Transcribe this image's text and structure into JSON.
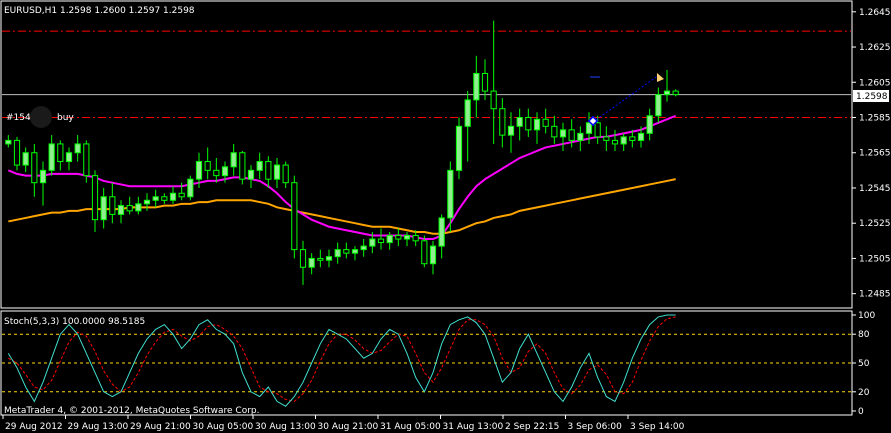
{
  "symbol_header": "EURUSD,H1  1.2598 1.2600 1.2597 1.2598",
  "trade_label_id": "#154",
  "trade_label_side": "buy",
  "current_price_label": "1.2598",
  "stoch_header": "Stoch(5,3,3) 100.0000 98.5185",
  "copyright": "MetaTrader 4, © 2001-2012, MetaQuotes Software Corp.",
  "colors": {
    "background": "#000000",
    "grid_axis": "#ffffff",
    "bull_candle": "#90ee90",
    "bear_candle": "#000000",
    "candle_wick": "#00ff00",
    "ma_fast": "#ff00ff",
    "ma_slow": "#ffa500",
    "level_lines": "#ff0000",
    "stoch_main": "#40e0d0",
    "stoch_signal": "#ff0000",
    "stoch_levels": "#ffd700",
    "trade_line": "#0000ff"
  },
  "chart_data": [
    {
      "type": "candlestick",
      "title": "EURUSD,H1",
      "ylim": [
        1.2478,
        1.265
      ],
      "y_ticks": [
        "1.2645",
        "1.2625",
        "1.2605",
        "1.2585",
        "1.2565",
        "1.2545",
        "1.2525",
        "1.2505",
        "1.2485"
      ],
      "x_ticks": [
        "29 Aug 2012",
        "29 Aug 13:00",
        "29 Aug 21:00",
        "30 Aug 05:00",
        "30 Aug 13:00",
        "30 Aug 21:00",
        "31 Aug 05:00",
        "31 Aug 13:00",
        "2 Sep 22:15",
        "3 Sep 06:00",
        "3 Sep 14:00"
      ],
      "horizontal_levels": [
        1.2634,
        1.2585
      ],
      "current_price": 1.2598,
      "candles": [
        [
          1.257,
          1.2575,
          1.2568,
          1.2572
        ],
        [
          1.2572,
          1.2574,
          1.2555,
          1.2558
        ],
        [
          1.2558,
          1.2568,
          1.2554,
          1.2565
        ],
        [
          1.2565,
          1.257,
          1.254,
          1.2548
        ],
        [
          1.2548,
          1.256,
          1.2535,
          1.2555
        ],
        [
          1.2555,
          1.2575,
          1.2552,
          1.257
        ],
        [
          1.257,
          1.2572,
          1.2555,
          1.256
        ],
        [
          1.256,
          1.2568,
          1.2555,
          1.2565
        ],
        [
          1.2565,
          1.2575,
          1.256,
          1.257
        ],
        [
          1.257,
          1.2572,
          1.2548,
          1.2552
        ],
        [
          1.2552,
          1.2555,
          1.252,
          1.2527
        ],
        [
          1.2527,
          1.2545,
          1.2522,
          1.254
        ],
        [
          1.254,
          1.2548,
          1.2525,
          1.253
        ],
        [
          1.253,
          1.2538,
          1.2525,
          1.2535
        ],
        [
          1.2535,
          1.254,
          1.253,
          1.2532
        ],
        [
          1.2532,
          1.254,
          1.253,
          1.2536
        ],
        [
          1.2536,
          1.2542,
          1.2532,
          1.2538
        ],
        [
          1.2538,
          1.2544,
          1.2534,
          1.254
        ],
        [
          1.254,
          1.2542,
          1.2536,
          1.2538
        ],
        [
          1.2538,
          1.2546,
          1.2536,
          1.2542
        ],
        [
          1.2542,
          1.2548,
          1.2538,
          1.254
        ],
        [
          1.254,
          1.2552,
          1.2538,
          1.255
        ],
        [
          1.255,
          1.2565,
          1.2545,
          1.256
        ],
        [
          1.256,
          1.2568,
          1.255,
          1.2555
        ],
        [
          1.2555,
          1.2562,
          1.2548,
          1.2552
        ],
        [
          1.2552,
          1.256,
          1.2548,
          1.2557
        ],
        [
          1.2557,
          1.257,
          1.2552,
          1.2565
        ],
        [
          1.2565,
          1.2566,
          1.2547,
          1.255
        ],
        [
          1.255,
          1.2558,
          1.2545,
          1.2555
        ],
        [
          1.2555,
          1.2565,
          1.255,
          1.256
        ],
        [
          1.256,
          1.2563,
          1.2545,
          1.255
        ],
        [
          1.255,
          1.2562,
          1.2545,
          1.2558
        ],
        [
          1.2558,
          1.256,
          1.2545,
          1.2548
        ],
        [
          1.2548,
          1.2552,
          1.2505,
          1.251
        ],
        [
          1.251,
          1.2515,
          1.249,
          1.25
        ],
        [
          1.25,
          1.2508,
          1.2496,
          1.2505
        ],
        [
          1.2505,
          1.251,
          1.25,
          1.2504
        ],
        [
          1.2504,
          1.251,
          1.25,
          1.2506
        ],
        [
          1.2506,
          1.2514,
          1.2502,
          1.251
        ],
        [
          1.251,
          1.2514,
          1.2505,
          1.2508
        ],
        [
          1.2508,
          1.2512,
          1.2504,
          1.251
        ],
        [
          1.251,
          1.2516,
          1.2506,
          1.2512
        ],
        [
          1.2512,
          1.252,
          1.2508,
          1.2516
        ],
        [
          1.2516,
          1.2522,
          1.251,
          1.2514
        ],
        [
          1.2514,
          1.252,
          1.251,
          1.2518
        ],
        [
          1.2518,
          1.2522,
          1.2512,
          1.2516
        ],
        [
          1.2516,
          1.252,
          1.2512,
          1.2518
        ],
        [
          1.2518,
          1.2521,
          1.2512,
          1.2515
        ],
        [
          1.2515,
          1.2518,
          1.25,
          1.2502
        ],
        [
          1.2502,
          1.2515,
          1.2496,
          1.2512
        ],
        [
          1.2512,
          1.253,
          1.2505,
          1.2528
        ],
        [
          1.2528,
          1.256,
          1.252,
          1.2555
        ],
        [
          1.2555,
          1.2585,
          1.255,
          1.258
        ],
        [
          1.258,
          1.26,
          1.256,
          1.2595
        ],
        [
          1.2595,
          1.262,
          1.2585,
          1.261
        ],
        [
          1.261,
          1.2618,
          1.2595,
          1.26
        ],
        [
          1.26,
          1.264,
          1.257,
          1.259
        ],
        [
          1.259,
          1.2596,
          1.2568,
          1.2575
        ],
        [
          1.2575,
          1.2588,
          1.2565,
          1.258
        ],
        [
          1.258,
          1.259,
          1.2572,
          1.2585
        ],
        [
          1.2585,
          1.259,
          1.2574,
          1.2578
        ],
        [
          1.2578,
          1.2588,
          1.257,
          1.2584
        ],
        [
          1.2584,
          1.259,
          1.2576,
          1.258
        ],
        [
          1.258,
          1.2586,
          1.257,
          1.2574
        ],
        [
          1.2574,
          1.2582,
          1.2566,
          1.2578
        ],
        [
          1.2578,
          1.2584,
          1.2568,
          1.2572
        ],
        [
          1.2572,
          1.258,
          1.2566,
          1.2576
        ],
        [
          1.2576,
          1.2588,
          1.257,
          1.2582
        ],
        [
          1.2582,
          1.2586,
          1.257,
          1.2574
        ],
        [
          1.2574,
          1.258,
          1.2566,
          1.2572
        ],
        [
          1.2572,
          1.2578,
          1.2566,
          1.257
        ],
        [
          1.257,
          1.2576,
          1.2566,
          1.2574
        ],
        [
          1.2574,
          1.2578,
          1.2568,
          1.2572
        ],
        [
          1.2572,
          1.258,
          1.2568,
          1.2576
        ],
        [
          1.2576,
          1.259,
          1.2572,
          1.2586
        ],
        [
          1.2586,
          1.2602,
          1.2582,
          1.2598
        ],
        [
          1.2598,
          1.2612,
          1.2594,
          1.26
        ],
        [
          1.26,
          1.2601,
          1.2597,
          1.2598
        ]
      ],
      "ma_fast": [
        1.2555,
        1.2553,
        1.2552,
        1.2552,
        1.2552,
        1.2553,
        1.2553,
        1.2553,
        1.2553,
        1.2552,
        1.2551,
        1.2549,
        1.2548,
        1.2547,
        1.2546,
        1.2546,
        1.2546,
        1.2546,
        1.2546,
        1.2546,
        1.2546,
        1.2547,
        1.2548,
        1.2549,
        1.2549,
        1.255,
        1.2551,
        1.2551,
        1.255,
        1.2549,
        1.2546,
        1.2542,
        1.2537,
        1.2533,
        1.253,
        1.2527,
        1.2525,
        1.2523,
        1.2522,
        1.2521,
        1.252,
        1.2519,
        1.2518,
        1.2518,
        1.2518,
        1.2518,
        1.2518,
        1.2517,
        1.2516,
        1.2516,
        1.2518,
        1.2525,
        1.2533,
        1.254,
        1.2546,
        1.255,
        1.2553,
        1.2556,
        1.2559,
        1.2562,
        1.2564,
        1.2566,
        1.2568,
        1.2569,
        1.257,
        1.2571,
        1.2572,
        1.2573,
        1.2574,
        1.2574,
        1.2575,
        1.2576,
        1.2577,
        1.2578,
        1.258,
        1.2582,
        1.2584,
        1.2586
      ],
      "ma_slow": [
        1.2526,
        1.2527,
        1.2528,
        1.2529,
        1.253,
        1.2531,
        1.2531,
        1.2532,
        1.2532,
        1.2533,
        1.2533,
        1.2533,
        1.2533,
        1.2533,
        1.2534,
        1.2534,
        1.2534,
        1.2534,
        1.2535,
        1.2535,
        1.2536,
        1.2536,
        1.2537,
        1.2537,
        1.2538,
        1.2538,
        1.2538,
        1.2538,
        1.2538,
        1.2537,
        1.2536,
        1.2534,
        1.2533,
        1.2532,
        1.2531,
        1.253,
        1.2529,
        1.2528,
        1.2527,
        1.2526,
        1.2525,
        1.2524,
        1.2523,
        1.2523,
        1.2523,
        1.2522,
        1.2521,
        1.252,
        1.252,
        1.2519,
        1.2519,
        1.252,
        1.2521,
        1.2523,
        1.2525,
        1.2526,
        1.2528,
        1.2529,
        1.253,
        1.2532,
        1.2533,
        1.2534,
        1.2535,
        1.2536,
        1.2537,
        1.2538,
        1.2539,
        1.254,
        1.2541,
        1.2542,
        1.2543,
        1.2544,
        1.2545,
        1.2546,
        1.2547,
        1.2548,
        1.2549,
        1.255
      ]
    },
    {
      "type": "line",
      "title": "Stoch(5,3,3)",
      "ylim": [
        0,
        100
      ],
      "y_ticks": [
        "100",
        "80",
        "50",
        "20",
        "0"
      ],
      "levels": [
        80,
        50,
        20
      ],
      "series": [
        {
          "values": [
            60,
            45,
            25,
            10,
            30,
            55,
            80,
            90,
            80,
            60,
            40,
            20,
            15,
            20,
            40,
            60,
            75,
            85,
            90,
            80,
            65,
            75,
            90,
            95,
            85,
            80,
            70,
            40,
            20,
            15,
            25,
            10,
            5,
            15,
            30,
            50,
            70,
            85,
            80,
            75,
            65,
            55,
            60,
            75,
            85,
            80,
            60,
            35,
            20,
            40,
            70,
            90,
            95,
            98,
            92,
            80,
            55,
            30,
            40,
            65,
            80,
            60,
            40,
            20,
            10,
            25,
            45,
            60,
            35,
            15,
            10,
            30,
            55,
            75,
            90,
            98,
            100,
            100
          ]
        },
        {
          "values": [
            55,
            50,
            38,
            25,
            22,
            32,
            52,
            72,
            82,
            78,
            62,
            42,
            28,
            20,
            25,
            40,
            58,
            72,
            82,
            85,
            78,
            73,
            78,
            88,
            90,
            85,
            78,
            65,
            45,
            25,
            20,
            18,
            12,
            10,
            18,
            32,
            52,
            70,
            80,
            80,
            74,
            65,
            60,
            63,
            72,
            80,
            78,
            60,
            40,
            30,
            45,
            65,
            85,
            95,
            95,
            90,
            78,
            55,
            40,
            45,
            62,
            70,
            60,
            40,
            23,
            18,
            27,
            43,
            48,
            38,
            20,
            18,
            30,
            53,
            73,
            88,
            96,
            98
          ]
        }
      ]
    }
  ]
}
